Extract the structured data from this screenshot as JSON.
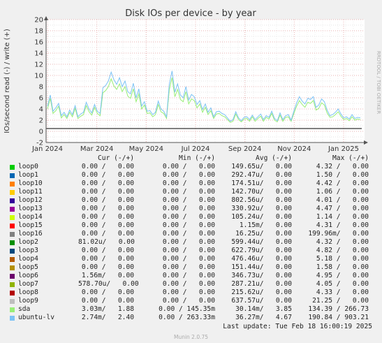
{
  "chart_data": {
    "type": "line",
    "title": "Disk IOs per device - by year",
    "ylabel": "IOs/second read (-) / write (+)",
    "watermark": "RRDTOOL / TOBI OETIKER",
    "ylim": [
      -2,
      20
    ],
    "yticks": [
      -2,
      0,
      2,
      4,
      6,
      8,
      10,
      12,
      14,
      16,
      18,
      20
    ],
    "xticks": [
      "Jan 2024",
      "Mar 2024",
      "May 2024",
      "Jul 2024",
      "Sep 2024",
      "Nov 2024",
      "Jan 2025"
    ],
    "grid": true,
    "series": [
      {
        "name": "ubuntu-lv",
        "color": "#7cc3f5",
        "values": [
          4.5,
          6.5,
          3.6,
          4.2,
          5.0,
          2.8,
          3.4,
          2.6,
          3.8,
          3.0,
          4.6,
          2.6,
          3.1,
          3.4,
          5.2,
          4.0,
          3.3,
          4.8,
          3.6,
          3.2,
          7.8,
          8.2,
          9.0,
          10.6,
          9.2,
          8.4,
          9.6,
          8.0,
          9.0,
          7.1,
          6.7,
          8.6,
          6.0,
          7.6,
          4.5,
          5.3,
          3.6,
          3.7,
          3.0,
          3.4,
          5.4,
          4.0,
          3.6,
          2.6,
          8.4,
          10.8,
          7.0,
          8.5,
          6.5,
          6.0,
          8.0,
          5.6,
          6.6,
          6.2,
          4.8,
          5.5,
          3.9,
          4.9,
          3.4,
          4.2,
          2.6,
          3.5,
          3.6,
          3.2,
          3.0,
          2.4,
          1.8,
          2.1,
          3.5,
          2.4,
          1.9,
          2.5,
          2.6,
          2.1,
          2.9,
          2.1,
          2.6,
          3.1,
          2.1,
          2.8,
          2.5,
          3.6,
          2.3,
          1.9,
          3.3,
          2.1,
          2.8,
          3.0,
          2.0,
          3.6,
          5.1,
          6.2,
          5.4,
          4.9,
          5.9,
          5.7,
          6.2,
          4.3,
          4.7,
          5.8,
          5.3,
          3.8,
          2.8,
          3.0,
          3.4,
          4.0,
          3.1,
          2.4,
          2.6,
          2.2,
          3.0,
          2.3,
          2.5,
          2.4
        ]
      },
      {
        "name": "sda",
        "color": "#99ee77",
        "values": [
          4.0,
          5.9,
          3.2,
          3.7,
          4.5,
          2.4,
          3.0,
          2.3,
          3.4,
          2.6,
          4.1,
          2.3,
          2.7,
          3.0,
          4.6,
          3.5,
          2.9,
          4.3,
          3.2,
          2.8,
          6.9,
          7.3,
          8.0,
          9.4,
          8.1,
          7.5,
          8.5,
          7.1,
          8.0,
          6.3,
          5.9,
          7.6,
          5.3,
          6.7,
          4.0,
          4.7,
          3.2,
          3.3,
          2.6,
          3.0,
          4.8,
          3.5,
          3.2,
          2.3,
          7.4,
          9.6,
          6.2,
          7.5,
          5.7,
          5.3,
          7.1,
          4.9,
          5.8,
          5.5,
          4.2,
          4.9,
          3.4,
          4.3,
          3.0,
          3.7,
          2.3,
          3.1,
          3.2,
          2.8,
          2.6,
          2.1,
          1.6,
          1.8,
          3.1,
          2.1,
          1.7,
          2.2,
          2.3,
          1.8,
          2.6,
          1.8,
          2.3,
          2.7,
          1.8,
          2.5,
          2.2,
          3.2,
          2.0,
          1.7,
          2.9,
          1.8,
          2.5,
          2.6,
          1.8,
          3.2,
          4.5,
          5.5,
          4.8,
          4.3,
          5.2,
          5.0,
          5.5,
          3.8,
          4.1,
          5.1,
          4.7,
          3.3,
          2.5,
          2.6,
          3.0,
          3.5,
          2.7,
          2.1,
          2.3,
          1.9,
          2.6,
          2.0,
          2.2,
          2.1
        ]
      }
    ]
  },
  "legend": {
    "headers": {
      "cur": "Cur (-/+)",
      "min": "Min (-/+)",
      "avg": "Avg (-/+)",
      "max": "Max (-/+)"
    },
    "rows": [
      {
        "name": "loop0",
        "color": "#00cc00",
        "cur": "0.00 /   0.00",
        "min": "0.00 /   0.00",
        "avg": "149.65u/   0.00",
        "max": "4.32 /   0.00"
      },
      {
        "name": "loop1",
        "color": "#0066b3",
        "cur": "0.00 /   0.00",
        "min": "0.00 /   0.00",
        "avg": "292.47u/   0.00",
        "max": "1.50 /   0.00"
      },
      {
        "name": "loop10",
        "color": "#ff8000",
        "cur": "0.00 /   0.00",
        "min": "0.00 /   0.00",
        "avg": "174.51u/   0.00",
        "max": "4.42 /   0.00"
      },
      {
        "name": "loop11",
        "color": "#ffcc00",
        "cur": "0.00 /   0.00",
        "min": "0.00 /   0.00",
        "avg": "142.70u/   0.00",
        "max": "1.06 /   0.00"
      },
      {
        "name": "loop12",
        "color": "#330099",
        "cur": "0.00 /   0.00",
        "min": "0.00 /   0.00",
        "avg": "802.56u/   0.00",
        "max": "4.01 /   0.00"
      },
      {
        "name": "loop13",
        "color": "#990099",
        "cur": "0.00 /   0.00",
        "min": "0.00 /   0.00",
        "avg": "330.92u/   0.00",
        "max": "4.47 /   0.00"
      },
      {
        "name": "loop14",
        "color": "#ccff00",
        "cur": "0.00 /   0.00",
        "min": "0.00 /   0.00",
        "avg": "105.24u/   0.00",
        "max": "1.14 /   0.00"
      },
      {
        "name": "loop15",
        "color": "#ff0000",
        "cur": "0.00 /   0.00",
        "min": "0.00 /   0.00",
        "avg": "1.15m/   0.00",
        "max": "4.31 /   0.00"
      },
      {
        "name": "loop16",
        "color": "#808080",
        "cur": "0.00 /   0.00",
        "min": "0.00 /   0.00",
        "avg": "16.25u/   0.00",
        "max": "199.96m/   0.00"
      },
      {
        "name": "loop2",
        "color": "#008f00",
        "cur": "81.02u/   0.00",
        "min": "0.00 /   0.00",
        "avg": "599.44u/   0.00",
        "max": "4.32 /   0.00"
      },
      {
        "name": "loop3",
        "color": "#00487d",
        "cur": "0.00 /   0.00",
        "min": "0.00 /   0.00",
        "avg": "622.79u/   0.00",
        "max": "4.82 /   0.00"
      },
      {
        "name": "loop4",
        "color": "#b35a00",
        "cur": "0.00 /   0.00",
        "min": "0.00 /   0.00",
        "avg": "476.46u/   0.00",
        "max": "5.18 /   0.00"
      },
      {
        "name": "loop5",
        "color": "#b38f00",
        "cur": "0.00 /   0.00",
        "min": "0.00 /   0.00",
        "avg": "151.44u/   0.00",
        "max": "1.58 /   0.00"
      },
      {
        "name": "loop6",
        "color": "#6b006b",
        "cur": "1.56m/   0.00",
        "min": "0.00 /   0.00",
        "avg": "346.73u/   0.00",
        "max": "4.95 /   0.00"
      },
      {
        "name": "loop7",
        "color": "#8fb300",
        "cur": "578.70u/   0.00",
        "min": "0.00 /   0.00",
        "avg": "287.21u/   0.00",
        "max": "4.05 /   0.00"
      },
      {
        "name": "loop8",
        "color": "#b30000",
        "cur": "0.00 /   0.00",
        "min": "0.00 /   0.00",
        "avg": "215.62u/   0.00",
        "max": "4.33 /   0.00"
      },
      {
        "name": "loop9",
        "color": "#bebebe",
        "cur": "0.00 /   0.00",
        "min": "0.00 /   0.00",
        "avg": "637.57u/   0.00",
        "max": "21.25 /   0.00"
      },
      {
        "name": "sda",
        "color": "#99ee77",
        "cur": "3.03m/   1.88",
        "min": "0.00 / 145.35m",
        "avg": "30.14m/   3.85",
        "max": "134.39 / 266.73"
      },
      {
        "name": "ubuntu-lv",
        "color": "#7cc3f5",
        "cur": "2.74m/   2.40",
        "min": "0.00 / 263.33m",
        "avg": "36.27m/   4.67",
        "max": "190.84 / 903.21"
      }
    ]
  },
  "last_update": "Last update: Tue Feb 18 16:00:19 2025",
  "footer": "Munin 2.0.75"
}
